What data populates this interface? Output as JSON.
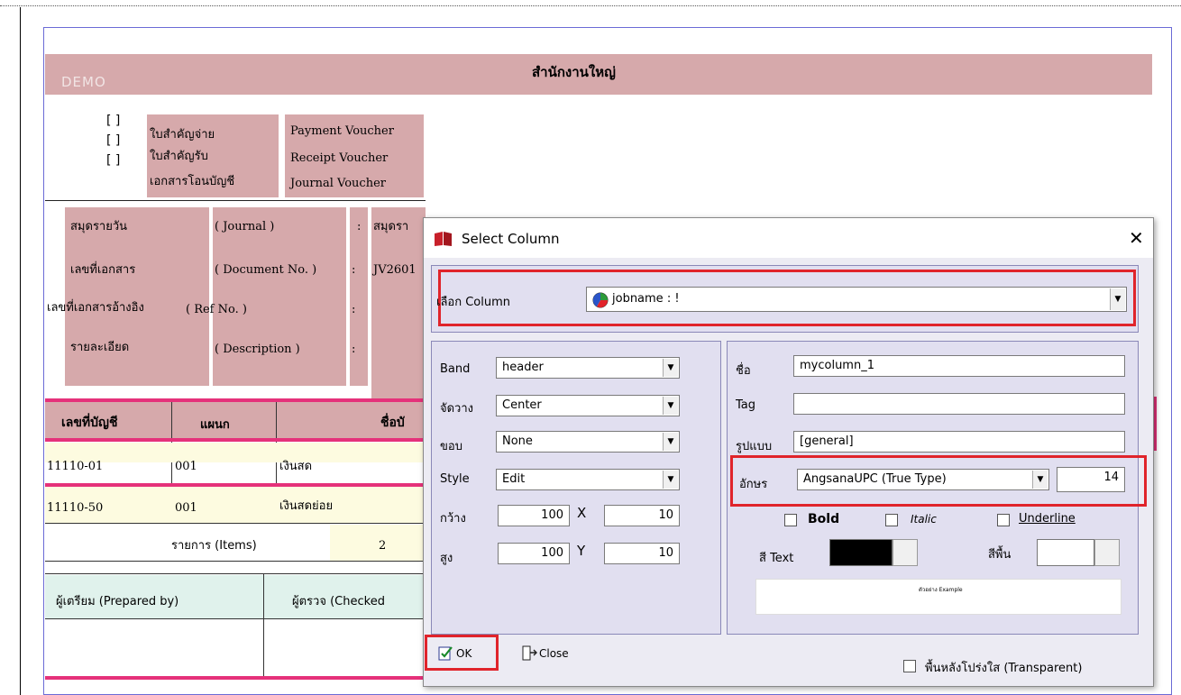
{
  "report": {
    "demo": "DEMO",
    "header_title": "สำนักงานใหญ่",
    "vouchers": [
      {
        "mark": "[ ]",
        "thai": "ใบสำคัญจ่าย",
        "eng": "Payment Voucher"
      },
      {
        "mark": "[ ]",
        "thai": "ใบสำคัญรับ",
        "eng": "Receipt Voucher"
      },
      {
        "mark": "[ ]",
        "thai": "เอกสารโอนบัญชี",
        "eng": "Journal Voucher"
      }
    ],
    "info_rows": [
      {
        "thai": "สมุดรายวัน",
        "eng": "( Journal )",
        "colon": ":",
        "value": "สมุดรา"
      },
      {
        "thai": "เลขที่เอกสาร",
        "eng": "( Document No. )",
        "colon": ":",
        "value": "JV2601"
      },
      {
        "thai": "เลขที่เอกสารอ้างอิง",
        "eng": "( Ref No. )",
        "colon": ":",
        "value": ""
      },
      {
        "thai": "รายละเอียด",
        "eng": "( Description )",
        "colon": ":",
        "value": ""
      }
    ],
    "table_headers": [
      "เลขที่บัญชี",
      "แผนก",
      "ชื่อบั"
    ],
    "rows": [
      {
        "account": "11110-01",
        "dept": "001",
        "name": "เงินสด"
      },
      {
        "account": "11110-50",
        "dept": "001",
        "name": "เงินสดย่อย"
      }
    ],
    "items_label": "รายการ (Items)",
    "items_count": "2",
    "prepared_by": "ผู้เตรียม (Prepared by)",
    "checked_by": "ผู้ตรวจ (Checked"
  },
  "dialog": {
    "title": "Select Column",
    "close_glyph": "✕",
    "select_column_label": "เลือก Column",
    "select_column_value": "jobname : !",
    "band_label": "Band",
    "band_value": "header",
    "align_label": "จัดวาง",
    "align_value": "Center",
    "border_label": "ขอบ",
    "border_value": "None",
    "style_label": "Style",
    "style_value": "Edit",
    "width_label": "กว้าง",
    "width_value": "100",
    "x_label": "X",
    "x_value": "10",
    "height_label": "สูง",
    "height_value": "100",
    "y_label": "Y",
    "y_value": "10",
    "name_label": "ชื่อ",
    "name_value": "mycolumn_1",
    "tag_label": "Tag",
    "tag_value": "",
    "format_label": "รูปแบบ",
    "format_value": "[general]",
    "font_label": "อักษร",
    "font_value": "AngsanaUPC (True Type)",
    "font_size": "14",
    "bold_label": "Bold",
    "italic_label": "Italic",
    "underline_label": "Underline",
    "text_color_label": "สี Text",
    "text_color": "#000000",
    "bg_color_label": "สีพื้น",
    "bg_color": "#ffffff",
    "example_text": "ตัวอย่าง Example",
    "ok_label": "OK",
    "close_label": "Close",
    "transparent_label": "พื้นหลังโปร่งใส (Transparent)"
  },
  "colors": {
    "rose": "#d6a9ab",
    "pink_rule": "#e5317a",
    "highlight": "#e0242b",
    "dialog_bg": "#ecebf3"
  }
}
